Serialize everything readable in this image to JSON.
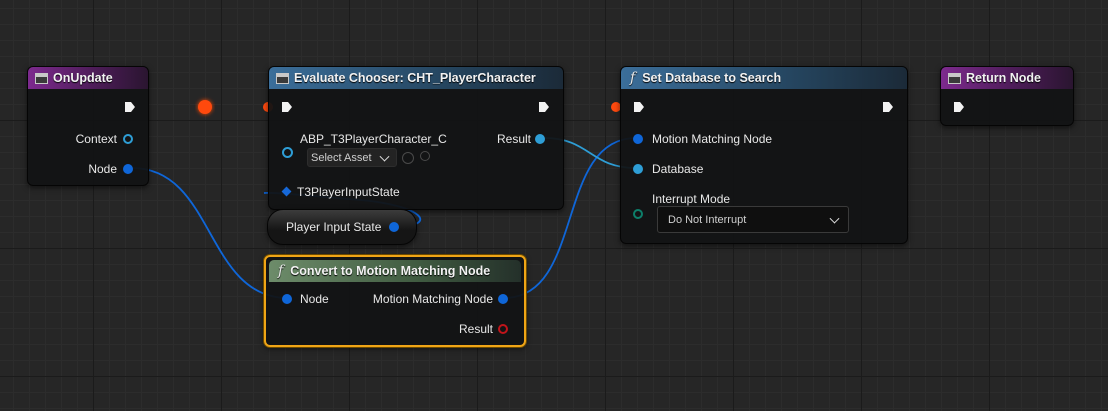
{
  "nodes": {
    "on_update": {
      "title": "OnUpdate",
      "context_label": "Context",
      "node_label": "Node"
    },
    "evaluate_chooser": {
      "title": "Evaluate Chooser: CHT_PlayerCharacter",
      "class_label": "ABP_T3PlayerCharacter_C",
      "select_asset": "Select Asset",
      "input_state_label": "T3PlayerInputState",
      "result_label": "Result"
    },
    "player_input_state": {
      "label": "Player Input State"
    },
    "set_database": {
      "title": "Set Database to Search",
      "mm_node_label": "Motion Matching Node",
      "database_label": "Database",
      "interrupt_label": "Interrupt Mode",
      "interrupt_value": "Do Not Interrupt"
    },
    "return_node": {
      "title": "Return Node"
    },
    "convert": {
      "title": "Convert to Motion Matching Node",
      "node_label": "Node",
      "mm_node_label": "Motion Matching Node",
      "result_label": "Result"
    }
  },
  "colors": {
    "exec_wire": "#ff4a0f",
    "struct_wire": "#0f66d8",
    "object_wire": "#2e9ed6",
    "function_header": "#3b6e9a",
    "event_header": "#7d2a8e",
    "pure_header": "#6d8c6a",
    "selection": "#f0a516"
  },
  "icons": {
    "function": "f",
    "exec_pin": "exec-arrow",
    "node_icon": "blueprint-node-icon"
  }
}
